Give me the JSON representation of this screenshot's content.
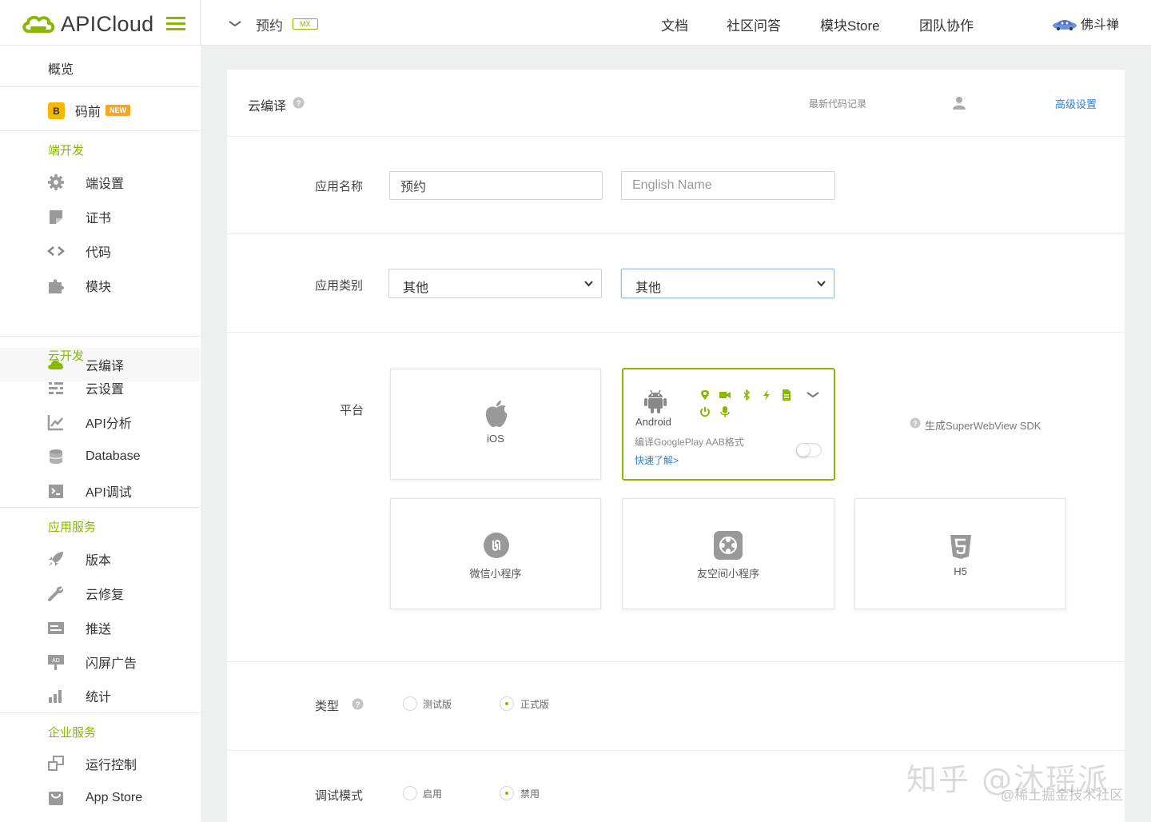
{
  "header": {
    "logo_text": "APICloud",
    "app_name": "预约",
    "app_badge": "MX",
    "nav": [
      "文档",
      "社区问答",
      "模块Store",
      "团队协作"
    ],
    "user_name": "佛斗禅"
  },
  "sidebar": {
    "overview": "概览",
    "maqian": {
      "label": "码前",
      "badge": "NEW"
    },
    "sections": [
      {
        "title": "端开发",
        "items": [
          {
            "label": "端设置",
            "icon": "gear-icon"
          },
          {
            "label": "证书",
            "icon": "certificate-icon"
          },
          {
            "label": "代码",
            "icon": "code-icon"
          },
          {
            "label": "模块",
            "icon": "puzzle-icon"
          },
          {
            "label": "云编译",
            "icon": "cloud-icon",
            "active": true
          }
        ]
      },
      {
        "title": "云开发",
        "items": [
          {
            "label": "云设置",
            "icon": "sliders-icon"
          },
          {
            "label": "API分析",
            "icon": "chart-icon"
          },
          {
            "label": "Database",
            "icon": "database-icon"
          },
          {
            "label": "API调试",
            "icon": "debug-icon"
          }
        ]
      },
      {
        "title": "应用服务",
        "items": [
          {
            "label": "版本",
            "icon": "rocket-icon"
          },
          {
            "label": "云修复",
            "icon": "wrench-icon"
          },
          {
            "label": "推送",
            "icon": "push-icon"
          },
          {
            "label": "闪屏广告",
            "icon": "ad-icon"
          },
          {
            "label": "统计",
            "icon": "bar-chart-icon"
          }
        ]
      },
      {
        "title": "企业服务",
        "items": [
          {
            "label": "运行控制",
            "icon": "windows-icon"
          },
          {
            "label": "App Store",
            "icon": "store-icon"
          }
        ]
      }
    ]
  },
  "main": {
    "title": "云编译",
    "latest_code": "最新代码记录",
    "advanced": "高级设置",
    "app_name_label": "应用名称",
    "app_name_value": "预约",
    "english_name_placeholder": "English Name",
    "category_label": "应用类别",
    "category_primary": "其他",
    "category_secondary": "其他",
    "platform_label": "平台",
    "platforms": {
      "ios": "iOS",
      "android": "Android",
      "android_aab": "编译GooglePlay AAB格式",
      "android_learn": "快速了解>",
      "wechat": "微信小程序",
      "youkongjian": "友空间小程序",
      "h5": "H5"
    },
    "sdk_link": "生成SuperWebView SDK",
    "type_label": "类型",
    "type_options": [
      "测试版",
      "正式版"
    ],
    "type_selected": "正式版",
    "debug_label": "调试模式",
    "debug_options": [
      "启用",
      "禁用"
    ],
    "debug_selected": "禁用"
  },
  "watermark": {
    "line1": "知乎 @沐瑶派",
    "line2": "@稀土掘金技术社区"
  },
  "colors": {
    "accent": "#8ab800",
    "link": "#2d7fd8",
    "background": "#eef0ef"
  }
}
